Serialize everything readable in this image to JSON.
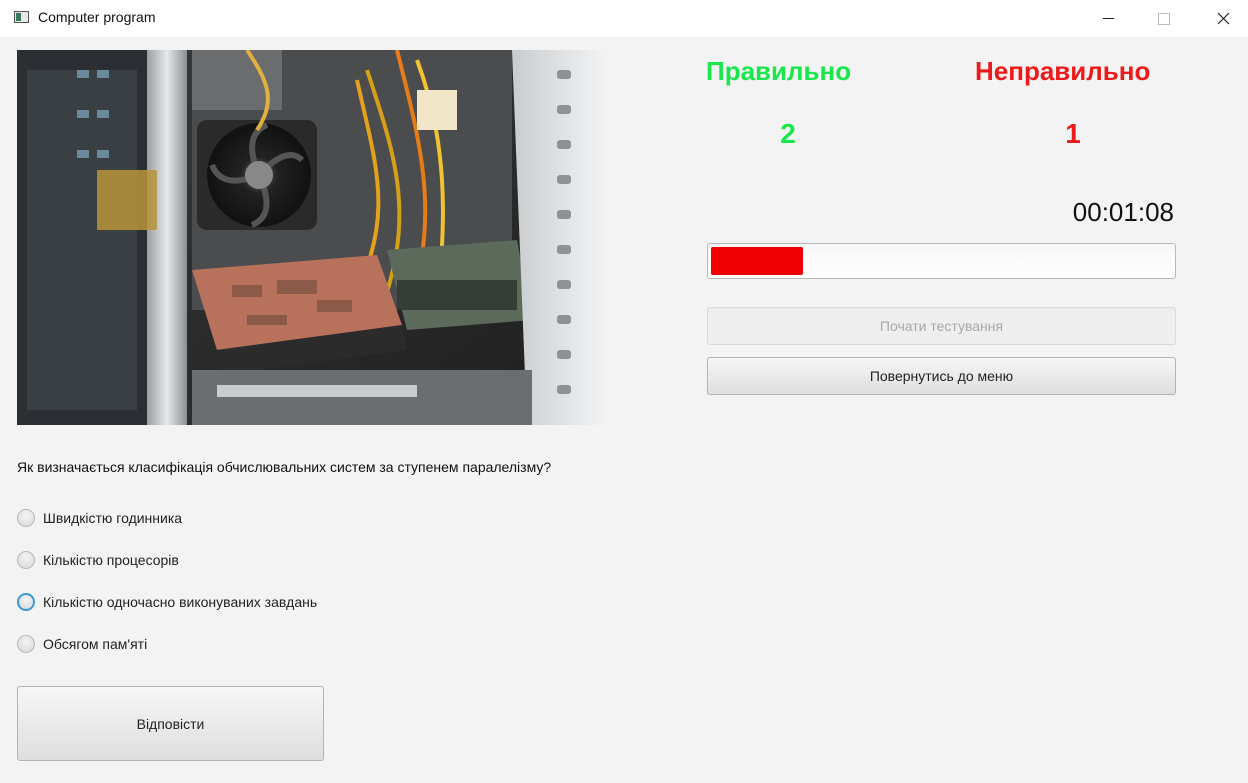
{
  "window": {
    "title": "Computer program",
    "controls": [
      "minimize",
      "maximize",
      "close"
    ]
  },
  "question": {
    "text": "Як визначається класифікація обчислювальних систем за ступенем паралелізму?",
    "options": [
      {
        "label": "Швидкістю годинника",
        "selected": false,
        "focused": false
      },
      {
        "label": "Кількістю процесорів",
        "selected": false,
        "focused": false
      },
      {
        "label": "Кількістю одночасно виконуваних завдань",
        "selected": false,
        "focused": true
      },
      {
        "label": "Обсягом пам'яті",
        "selected": false,
        "focused": false
      }
    ],
    "answer_button": "Відповісти"
  },
  "score": {
    "correct_label": "Правильно",
    "correct_value": "2",
    "wrong_label": "Неправильно",
    "wrong_value": "1",
    "correct_color": "#19e64a",
    "wrong_color": "#ee1a1a"
  },
  "timer": {
    "value": "00:01:08",
    "progress_fraction": 0.2,
    "progress_color": "#f00000"
  },
  "buttons": {
    "start_label": "Почати тестування",
    "start_disabled": true,
    "back_label": "Повернутись до меню"
  },
  "image": {
    "icon": "computer-internals-photo"
  }
}
